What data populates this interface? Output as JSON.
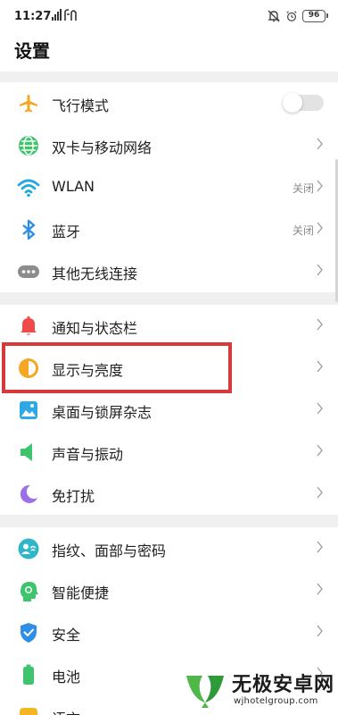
{
  "status": {
    "time": "11:27",
    "signal": "ᵛᴸ ıll ıfi",
    "battery": "96"
  },
  "header": {
    "title": "设置"
  },
  "groups": {
    "network": [
      {
        "label": "飞行模式",
        "icon": "airplane-icon",
        "control": "toggle",
        "toggle_on": false
      },
      {
        "label": "双卡与移动网络",
        "icon": "globe-icon",
        "control": "chevron"
      },
      {
        "label": "WLAN",
        "icon": "wifi-icon",
        "value": "关闭",
        "control": "chevron"
      },
      {
        "label": "蓝牙",
        "icon": "bluetooth-icon",
        "value": "关闭",
        "control": "chevron"
      },
      {
        "label": "其他无线连接",
        "icon": "more-connections-icon",
        "control": "chevron"
      }
    ],
    "display": [
      {
        "label": "通知与状态栏",
        "icon": "bell-icon",
        "control": "chevron"
      },
      {
        "label": "显示与亮度",
        "icon": "brightness-icon",
        "control": "chevron",
        "highlighted": true
      },
      {
        "label": "桌面与锁屏杂志",
        "icon": "wallpaper-icon",
        "control": "chevron"
      },
      {
        "label": "声音与振动",
        "icon": "speaker-icon",
        "control": "chevron"
      },
      {
        "label": "免打扰",
        "icon": "moon-icon",
        "control": "chevron"
      }
    ],
    "security": [
      {
        "label": "指纹、面部与密码",
        "icon": "fingerprint-face-icon",
        "control": "chevron"
      },
      {
        "label": "智能便捷",
        "icon": "smart-assist-icon",
        "control": "chevron"
      },
      {
        "label": "安全",
        "icon": "shield-icon",
        "control": "chevron"
      },
      {
        "label": "电池",
        "icon": "battery-settings-icon",
        "control": "chevron"
      },
      {
        "label": "语言",
        "icon": "language-icon",
        "control": "chevron"
      }
    ]
  },
  "colors": {
    "airplane": "#f5a623",
    "globe": "#3ec46d",
    "wifi": "#25a8e0",
    "bluetooth": "#2f8fe6",
    "more": "#8c8c8c",
    "bell": "#f04b4b",
    "brightness": "#f5a623",
    "wallpaper": "#2fa8e6",
    "speaker": "#3ec46d",
    "moon": "#9b6fe6",
    "fingerprint": "#2fb7c9",
    "smart": "#3ec46d",
    "shield": "#2f8fe6",
    "battery_icon": "#3ec46d",
    "language": "#f5b623",
    "highlight": "#d63a3a"
  },
  "watermark": {
    "name": "无极安卓网",
    "url": "wjhotelgroup.com"
  }
}
